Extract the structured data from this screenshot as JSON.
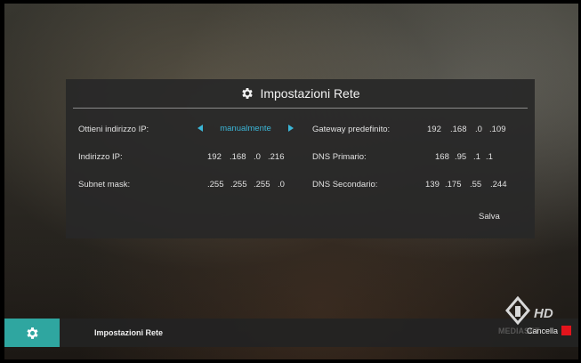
{
  "dialog": {
    "title": "Impostazioni Rete",
    "icon": "gear-icon",
    "save_label": "Salva"
  },
  "left_fields": {
    "ip_mode": {
      "label": "Ottieni indirizzo IP:",
      "value": "manualmente"
    },
    "ip_address": {
      "label": "Indirizzo IP:",
      "octets": [
        "192",
        ".168",
        ".0",
        ".216"
      ]
    },
    "subnet_mask": {
      "label": "Subnet mask:",
      "octets": [
        ".255",
        ".255",
        ".255",
        ".0"
      ]
    }
  },
  "right_fields": {
    "gateway": {
      "label": "Gateway predefinito:",
      "octets": [
        "192",
        ".168",
        ".0",
        ".109"
      ]
    },
    "dns_primary": {
      "label": "DNS Primario:",
      "octets": [
        "168",
        ".95",
        ".1",
        ".1"
      ]
    },
    "dns_secondary": {
      "label": "DNS Secondario:",
      "octets": [
        "139",
        ".175",
        ".55",
        ".244"
      ]
    }
  },
  "bottom_bar": {
    "section_label": "Impostazioni Rete",
    "cancel_label": "Cancella",
    "cancel_key_color": "#e3141c"
  },
  "logo": {
    "brand": "MEDIASET",
    "hd_label": "HD"
  },
  "colors": {
    "accent": "#3bb5d6",
    "menu_teal": "#2fa6a0"
  }
}
